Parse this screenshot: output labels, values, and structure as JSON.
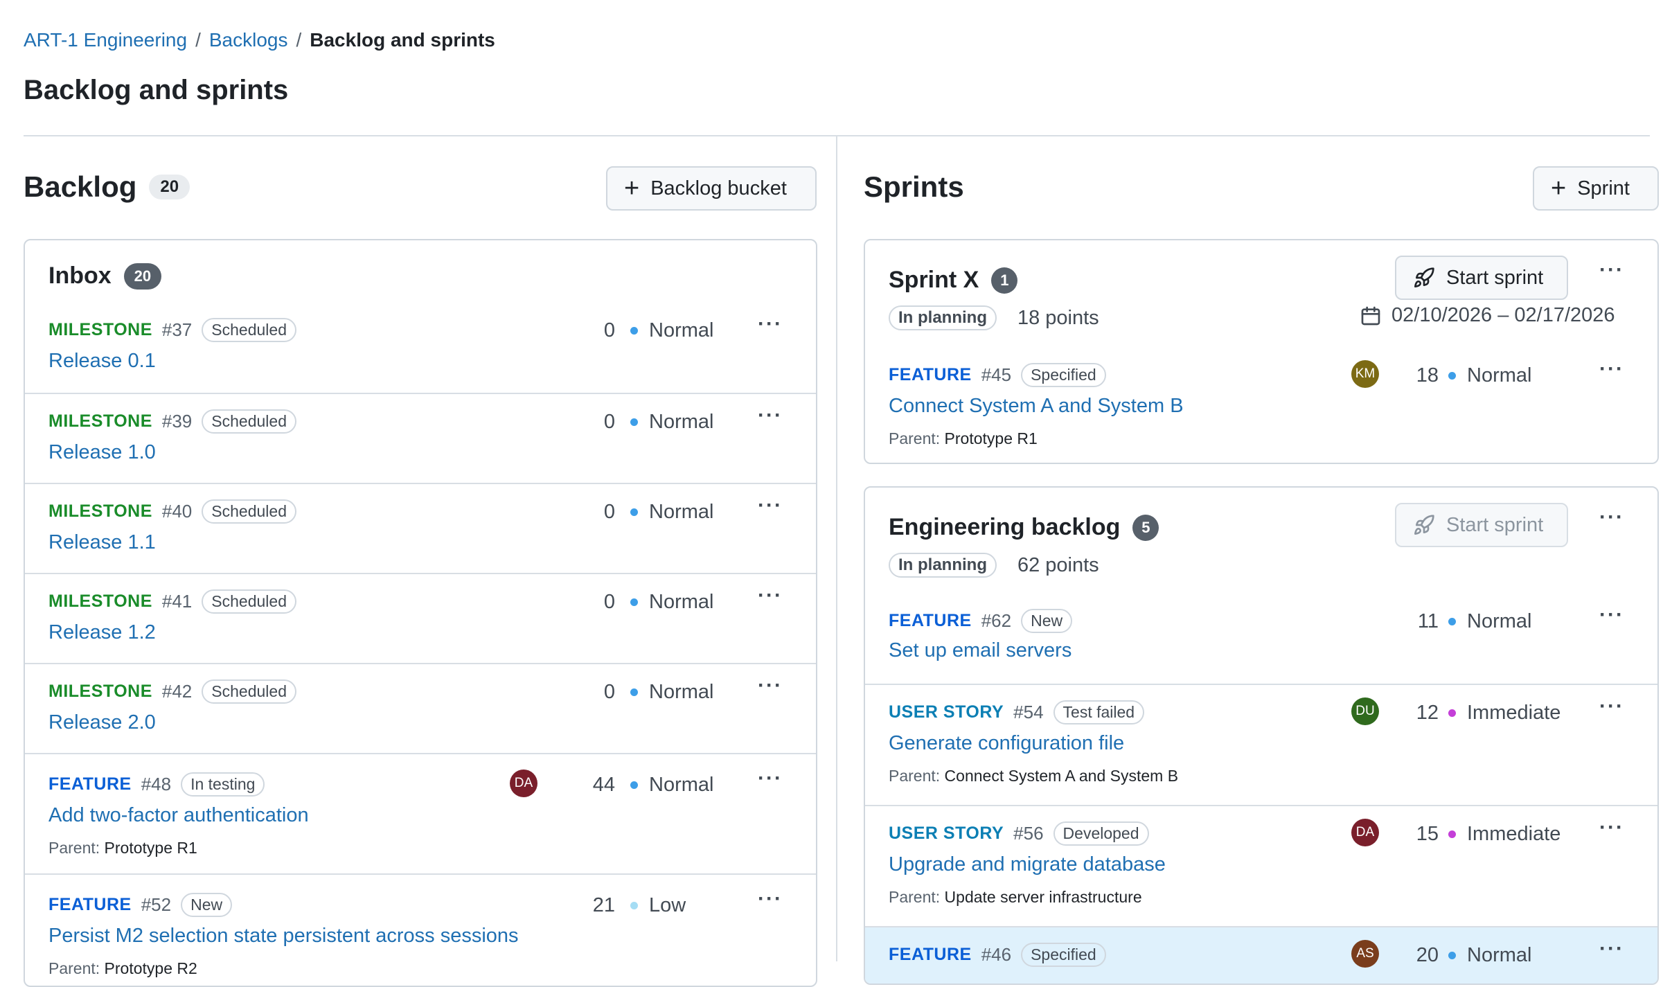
{
  "breadcrumb": {
    "items": [
      "ART-1 Engineering",
      "Backlogs"
    ],
    "current": "Backlog and sprints",
    "separator": "/"
  },
  "page": {
    "title": "Backlog and sprints"
  },
  "backlog": {
    "title": "Backlog",
    "count": "20",
    "add_button": "Backlog bucket",
    "inbox": {
      "title": "Inbox",
      "count": "20",
      "items": [
        {
          "type": "MILESTONE",
          "number": "#37",
          "status": "Scheduled",
          "title": "Release 0.1",
          "points": "0",
          "priority": "Normal"
        },
        {
          "type": "MILESTONE",
          "number": "#39",
          "status": "Scheduled",
          "title": "Release 1.0",
          "points": "0",
          "priority": "Normal"
        },
        {
          "type": "MILESTONE",
          "number": "#40",
          "status": "Scheduled",
          "title": "Release 1.1",
          "points": "0",
          "priority": "Normal"
        },
        {
          "type": "MILESTONE",
          "number": "#41",
          "status": "Scheduled",
          "title": "Release 1.2",
          "points": "0",
          "priority": "Normal"
        },
        {
          "type": "MILESTONE",
          "number": "#42",
          "status": "Scheduled",
          "title": "Release 2.0",
          "points": "0",
          "priority": "Normal"
        },
        {
          "type": "FEATURE",
          "number": "#48",
          "status": "In testing",
          "title": "Add two-factor authentication",
          "avatar": "DA",
          "points": "44",
          "priority": "Normal",
          "parent_label": "Parent:",
          "parent": "Prototype R1"
        },
        {
          "type": "FEATURE",
          "number": "#52",
          "status": "New",
          "title": "Persist M2 selection state persistent across sessions",
          "points": "21",
          "priority": "Low",
          "parent_label": "Parent:",
          "parent": "Prototype R2"
        }
      ]
    }
  },
  "sprints": {
    "title": "Sprints",
    "add_button": "Sprint",
    "start_label": "Start sprint",
    "list": [
      {
        "name": "Sprint X",
        "count": "1",
        "state": "In planning",
        "points": "18 points",
        "dates": "02/10/2026 – 02/17/2026",
        "items": [
          {
            "type": "FEATURE",
            "number": "#45",
            "status": "Specified",
            "title": "Connect System A and System B",
            "avatar": "KM",
            "points": "18",
            "priority": "Normal",
            "parent_label": "Parent:",
            "parent": "Prototype R1"
          }
        ]
      },
      {
        "name": "Engineering backlog",
        "count": "5",
        "state": "In planning",
        "points": "62 points",
        "items": [
          {
            "type": "FEATURE",
            "number": "#62",
            "status": "New",
            "title": "Set up email servers",
            "points": "11",
            "priority": "Normal"
          },
          {
            "type": "USER STORY",
            "number": "#54",
            "status": "Test failed",
            "title": "Generate configuration file",
            "avatar": "DU",
            "points": "12",
            "priority": "Immediate",
            "parent_label": "Parent:",
            "parent": "Connect System A and System B"
          },
          {
            "type": "USER STORY",
            "number": "#56",
            "status": "Developed",
            "title": "Upgrade and migrate database",
            "avatar": "DA",
            "points": "15",
            "priority": "Immediate",
            "parent_label": "Parent:",
            "parent": "Update server infrastructure"
          },
          {
            "type": "FEATURE",
            "number": "#46",
            "status": "Specified",
            "avatar": "AS",
            "points": "20",
            "priority": "Normal"
          }
        ]
      }
    ]
  },
  "colors": {
    "link": "#1f6fb2",
    "milestone": "#1a8c2a",
    "feature": "#0b5fd6",
    "user_story": "#0c7fb4",
    "priority_normal": "#3d9ee8",
    "priority_low": "#a5ddf4",
    "priority_immediate": "#c43fd8",
    "avatar_DA": "#7a1f2b",
    "avatar_KM": "#7c6a14",
    "avatar_DU": "#2f6a1d",
    "avatar_AS": "#7a3d1c",
    "highlight_row": "#dff1fc"
  },
  "icons": {
    "add": "plus-icon",
    "more": "kebab-icon",
    "start": "rocket-icon",
    "date": "calendar-icon"
  }
}
